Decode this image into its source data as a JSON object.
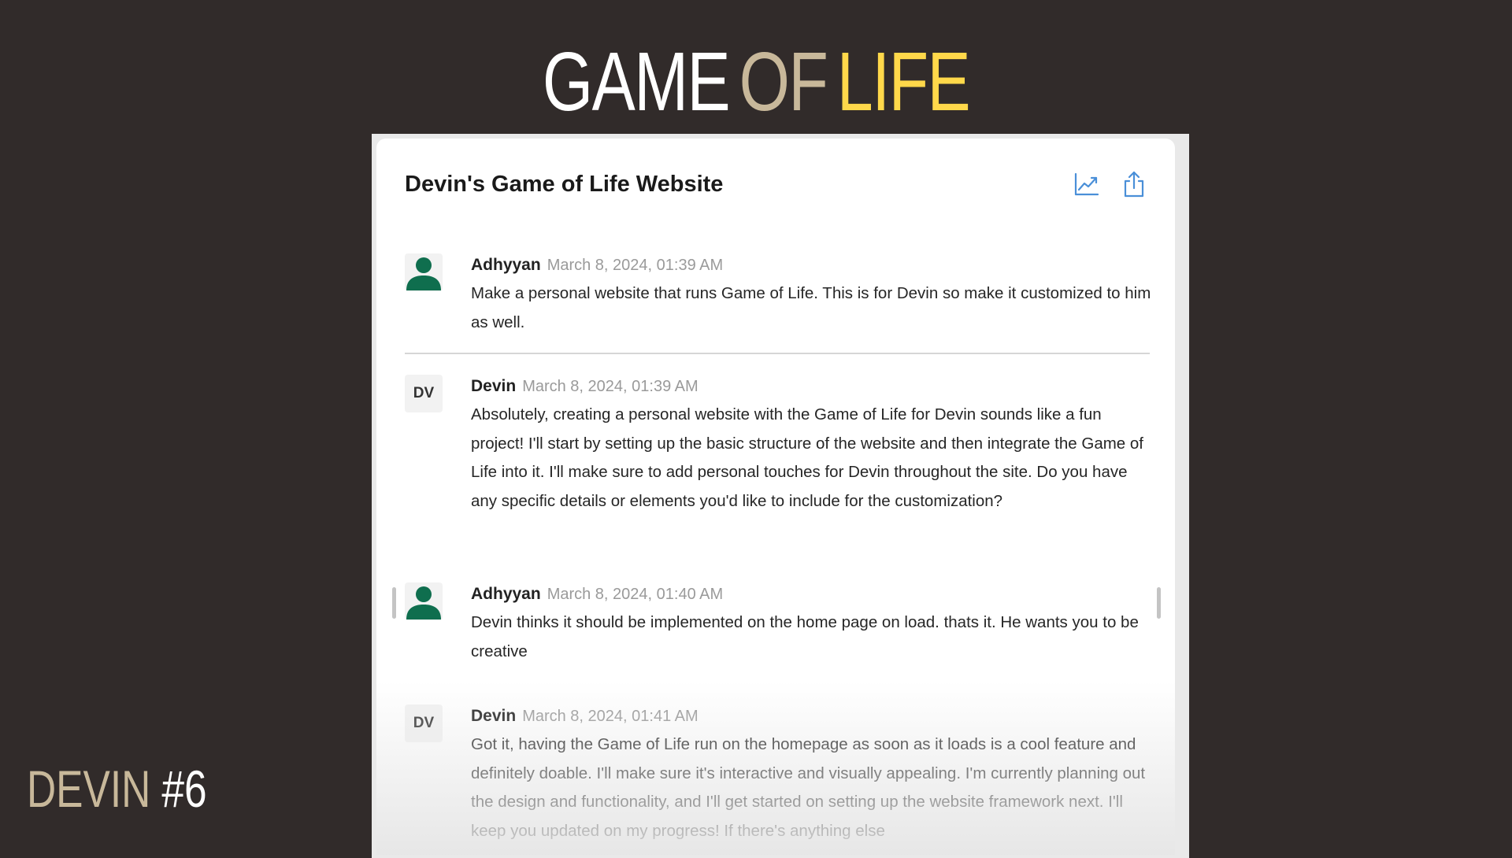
{
  "slide": {
    "title_words": [
      {
        "text": "GAME",
        "color": "#ffffff"
      },
      {
        "text": "OF",
        "color": "#c8b89a"
      },
      {
        "text": "LIFE",
        "color": "#ffd84a"
      }
    ],
    "corner_label": [
      {
        "text": "DEVIN",
        "color": "#c8b89a"
      },
      {
        "text": "#6",
        "color": "#ffffff"
      }
    ]
  },
  "panel": {
    "title": "Devin's Game of Life Website",
    "actions": [
      {
        "icon": "chart-line-icon"
      },
      {
        "icon": "share-icon"
      }
    ],
    "accent_color": "#4a8fd8",
    "user_avatar_color": "#0f6e4e"
  },
  "messages": [
    {
      "author": "Adhyyan",
      "avatar": "user-icon",
      "time": "March 8, 2024, 01:39 AM",
      "text": "Make a personal website that runs Game of Life. This is for Devin so make it customized to him as well."
    },
    {
      "author": "Devin",
      "avatar_initials": "DV",
      "time": "March 8, 2024, 01:39 AM",
      "text": "Absolutely, creating a personal website with the Game of Life for Devin sounds like a fun project! I'll start by setting up the basic structure of the website and then integrate the Game of Life into it. I'll make sure to add personal touches for Devin throughout the site. Do you have any specific details or elements you'd like to include for the customization?"
    },
    {
      "author": "Adhyyan",
      "avatar": "user-icon",
      "time": "March 8, 2024, 01:40 AM",
      "text": "Devin thinks it should be implemented on the home page on load. thats it. He wants you to be creative"
    },
    {
      "author": "Devin",
      "avatar_initials": "DV",
      "time": "March 8, 2024, 01:41 AM",
      "text": "Got it, having the Game of Life run on the homepage as soon as it loads is a cool feature and definitely doable. I'll make sure it's interactive and visually appealing. I'm currently planning out the design and functionality, and I'll get started on setting up the website framework next. I'll keep you updated on my progress! If there's anything else"
    }
  ]
}
